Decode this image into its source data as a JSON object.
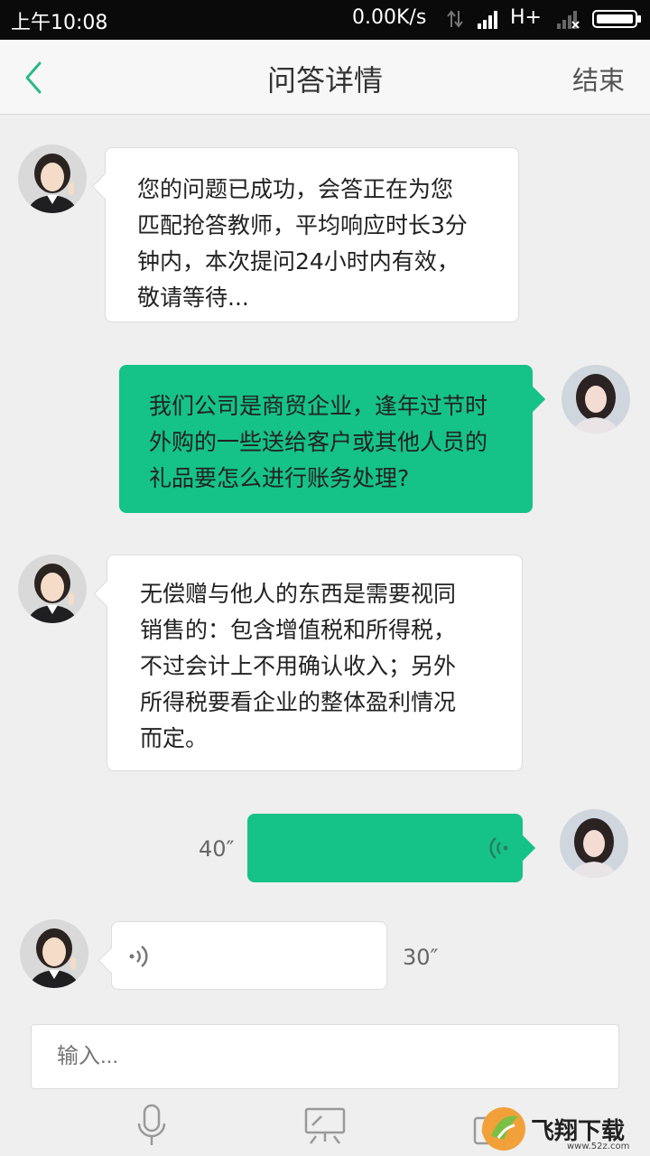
{
  "status_bar": {
    "time": "上午10:08",
    "speed": "0.00K/s",
    "network": "H+"
  },
  "header": {
    "title": "问答详情",
    "end_label": "结束"
  },
  "messages": [
    {
      "side": "left",
      "type": "text",
      "lines": [
        "您的问题已成功，会答正在为您",
        "匹配抢答教师，平均响应时长3分",
        "钟内，本次提问24小时内有效，",
        "敬请等待..."
      ]
    },
    {
      "side": "right",
      "type": "text",
      "lines": [
        "我们公司是商贸企业，逢年过节时",
        "外购的一些送给客户或其他人员的",
        "礼品要怎么进行账务处理?"
      ]
    },
    {
      "side": "left",
      "type": "text",
      "lines": [
        "无偿赠与他人的东西是需要视同",
        "销售的：包含增值税和所得税，",
        "不过会计上不用确认收入；另外",
        "所得税要看企业的整体盈利情况",
        "而定。"
      ]
    },
    {
      "side": "right",
      "type": "voice",
      "duration": "40″"
    },
    {
      "side": "left",
      "type": "voice",
      "duration": "30″"
    }
  ],
  "composer": {
    "placeholder": "输入..."
  },
  "watermark": {
    "text": "飞翔下载",
    "url": "www.52z.com"
  },
  "colors": {
    "accent": "#15c288",
    "back_arrow": "#2ab98a",
    "page_bg": "#efefef"
  }
}
